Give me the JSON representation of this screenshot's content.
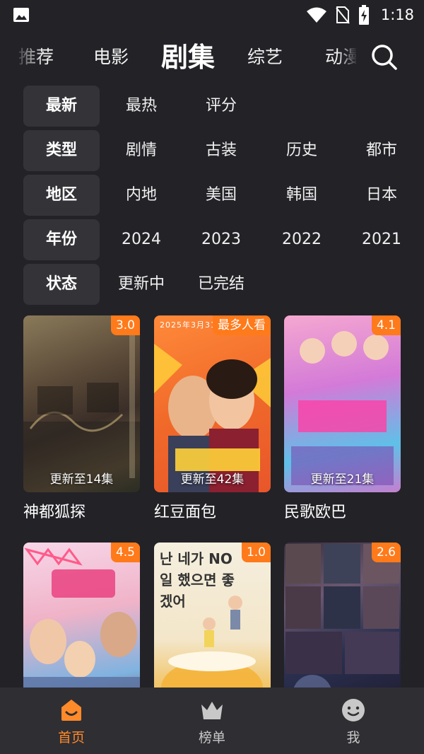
{
  "status_bar": {
    "time": "1:18"
  },
  "top_tabs": [
    {
      "label": "推荐"
    },
    {
      "label": "电影"
    },
    {
      "label": "剧集"
    },
    {
      "label": "综艺"
    },
    {
      "label": "动漫"
    }
  ],
  "filters": [
    {
      "label": "最新",
      "options": [
        "最热",
        "评分"
      ]
    },
    {
      "label": "类型",
      "options": [
        "剧情",
        "古装",
        "历史",
        "都市"
      ]
    },
    {
      "label": "地区",
      "options": [
        "内地",
        "美国",
        "韩国",
        "日本"
      ]
    },
    {
      "label": "年份",
      "options": [
        "2024",
        "2023",
        "2022",
        "2021"
      ]
    },
    {
      "label": "状态",
      "options": [
        "更新中",
        "已完结"
      ]
    }
  ],
  "cards": [
    {
      "title": "神都狐探",
      "badge": "3.0",
      "episodes": "更新至14集"
    },
    {
      "title": "红豆面包",
      "badge": "最多人看",
      "episodes": "更新至42集",
      "poster_text": "2025年3月31"
    },
    {
      "title": "民歌欧巴",
      "badge": "4.1",
      "episodes": "更新至21集"
    },
    {
      "title": "",
      "badge": "4.5",
      "episodes": ""
    },
    {
      "title": "",
      "badge": "1.0",
      "episodes": "",
      "poster_text": "난 네가 NO일 했으면 좋겠어"
    },
    {
      "title": "",
      "badge": "2.6",
      "episodes": ""
    }
  ],
  "bottom_nav": [
    {
      "label": "首页",
      "icon": "home-icon"
    },
    {
      "label": "榜单",
      "icon": "crown-icon"
    },
    {
      "label": "我",
      "icon": "smiley-icon"
    }
  ],
  "colors": {
    "accent": "#ff7a1a",
    "background": "#232227",
    "chip": "#343338"
  }
}
